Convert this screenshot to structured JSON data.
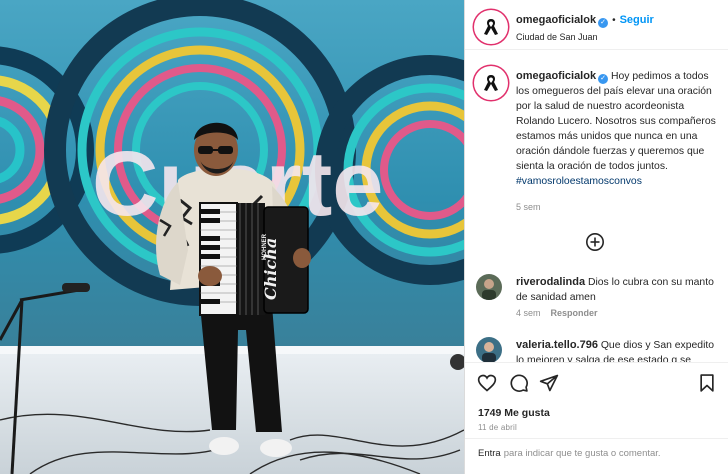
{
  "header": {
    "username": "omegaoficialok",
    "separator": "•",
    "follow_label": "Seguir",
    "location": "Ciudad de San Juan"
  },
  "caption": {
    "username": "omegaoficialok",
    "text": "Hoy pedimos a todos los omegueros del país elevar una oración por la salud de nuestro acordeonista Rolando Lucero. Nosotros sus compañeros estamos más unidos que nunca en una oración dándole fuerzas y queremos que sienta la oración de todos juntos.",
    "hashtag": "#vamosroloestamosconvos",
    "time": "5 sem"
  },
  "comments": [
    {
      "username": "riverodalinda",
      "text": "Dios lo cubra con su manto de sanidad amen",
      "time": "4 sem",
      "reply_label": "Responder"
    },
    {
      "username": "valeria.tello.796",
      "text": "Que dios y San expedito lo mejoren y salga de ese estado q se",
      "time": "",
      "reply_label": ""
    }
  ],
  "media": {
    "backdrop_text": "Cuarte",
    "accordion_brand": "Chicha",
    "accordion_maker": "HOHNER"
  },
  "actions": {
    "likes": "1749 Me gusta",
    "date": "11 de abril",
    "enter_label": "Entra",
    "comment_placeholder": "para indicar que te gusta o comentar."
  },
  "icons": [
    "black-ribbon-icon",
    "verified-badge-icon",
    "plus-circle-icon",
    "heart-icon",
    "comment-icon",
    "share-icon",
    "bookmark-icon"
  ],
  "colors": {
    "follow": "#0095f6",
    "verified": "#3897f0",
    "story_ring": "#e1306c",
    "hashtag": "#00376b",
    "muted": "#8e8e8e"
  }
}
